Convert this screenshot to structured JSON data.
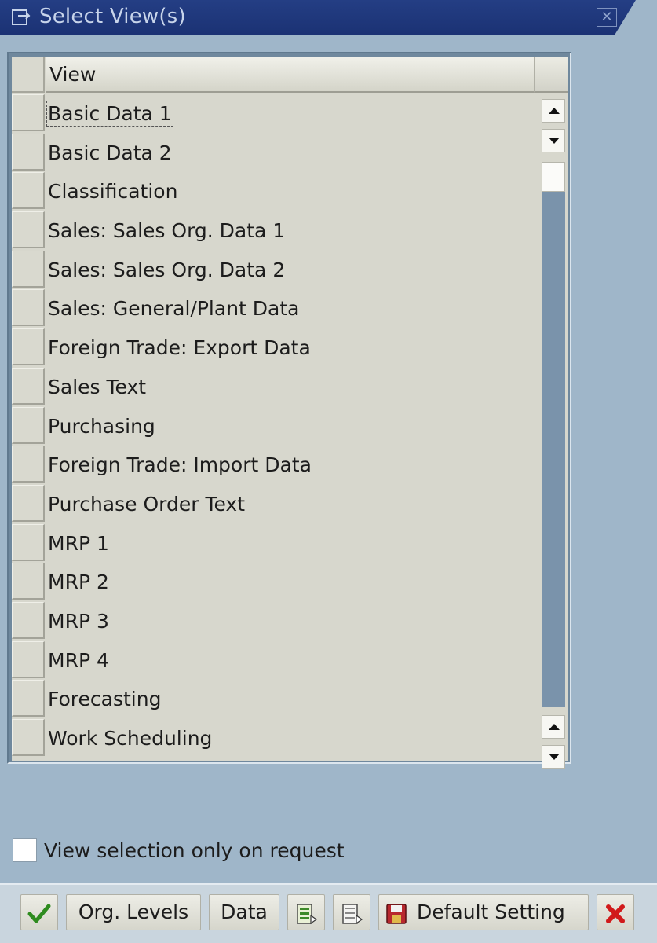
{
  "window": {
    "title": "Select View(s)",
    "close_symbol": "✕"
  },
  "table": {
    "column_header": "View",
    "rows": [
      {
        "label": "Basic Data 1",
        "focused": true
      },
      {
        "label": "Basic Data 2"
      },
      {
        "label": "Classification"
      },
      {
        "label": "Sales: Sales Org. Data 1"
      },
      {
        "label": "Sales: Sales Org. Data 2"
      },
      {
        "label": "Sales: General/Plant Data"
      },
      {
        "label": "Foreign Trade: Export Data"
      },
      {
        "label": "Sales Text"
      },
      {
        "label": "Purchasing"
      },
      {
        "label": "Foreign Trade: Import Data"
      },
      {
        "label": "Purchase Order Text"
      },
      {
        "label": "MRP 1"
      },
      {
        "label": "MRP 2"
      },
      {
        "label": "MRP 3"
      },
      {
        "label": "MRP 4"
      },
      {
        "label": "Forecasting"
      },
      {
        "label": "Work Scheduling"
      }
    ]
  },
  "options": {
    "view_selection_on_request_label": "View selection only on request",
    "view_selection_on_request_checked": false
  },
  "toolbar": {
    "org_levels_label": "Org. Levels",
    "data_label": "Data",
    "default_setting_label": "Default Setting",
    "icons": [
      "checkmark-icon",
      "select-all-icon",
      "deselect-all-icon",
      "save-icon",
      "cancel-icon"
    ]
  },
  "colors": {
    "title_bar": "#1f387b",
    "background": "#9fb6c9",
    "confirm_green": "#2e8b1f",
    "cancel_red": "#d11a1a"
  }
}
